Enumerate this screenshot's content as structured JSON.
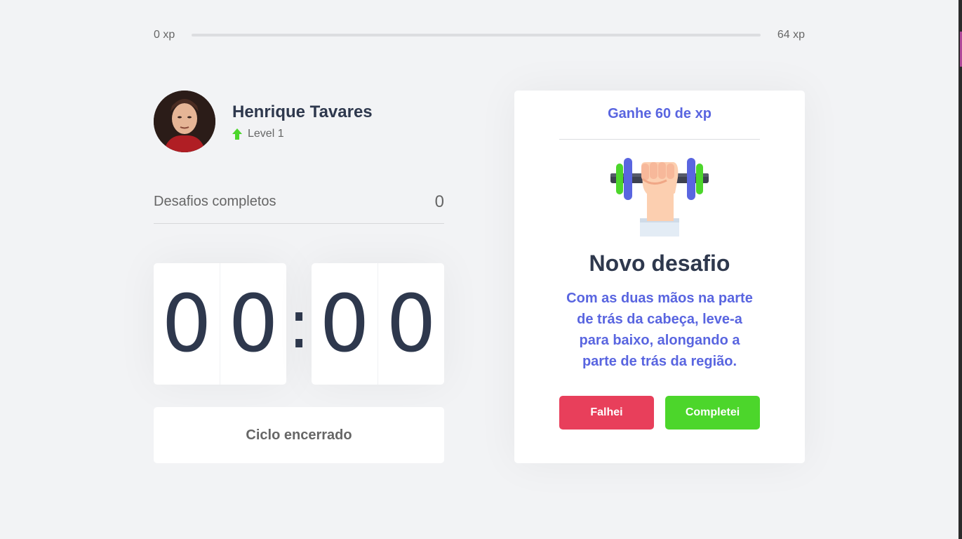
{
  "xp": {
    "min_label": "0 xp",
    "max_label": "64 xp",
    "progress": 0
  },
  "profile": {
    "name": "Henrique Tavares",
    "level_label": "Level 1",
    "level_icon": "arrow-up-icon"
  },
  "completed": {
    "label": "Desafios completos",
    "value": "0"
  },
  "countdown": {
    "minutes": [
      "0",
      "0"
    ],
    "seconds": [
      "0",
      "0"
    ],
    "separator": ":"
  },
  "cycle": {
    "label": "Ciclo encerrado"
  },
  "challenge": {
    "header": "Ganhe 60 de xp",
    "icon": "dumbbell-icon",
    "title": "Novo desafio",
    "description": "Com as duas mãos na parte de trás da cabeça, leve-a para baixo, alongando a parte de trás da região.",
    "fail_label": "Falhei",
    "success_label": "Completei"
  },
  "colors": {
    "accent": "#5965e0",
    "fail": "#e83f5b",
    "success": "#4cd62b",
    "title": "#2e384d",
    "text": "#666666",
    "background": "#f2f3f5"
  }
}
